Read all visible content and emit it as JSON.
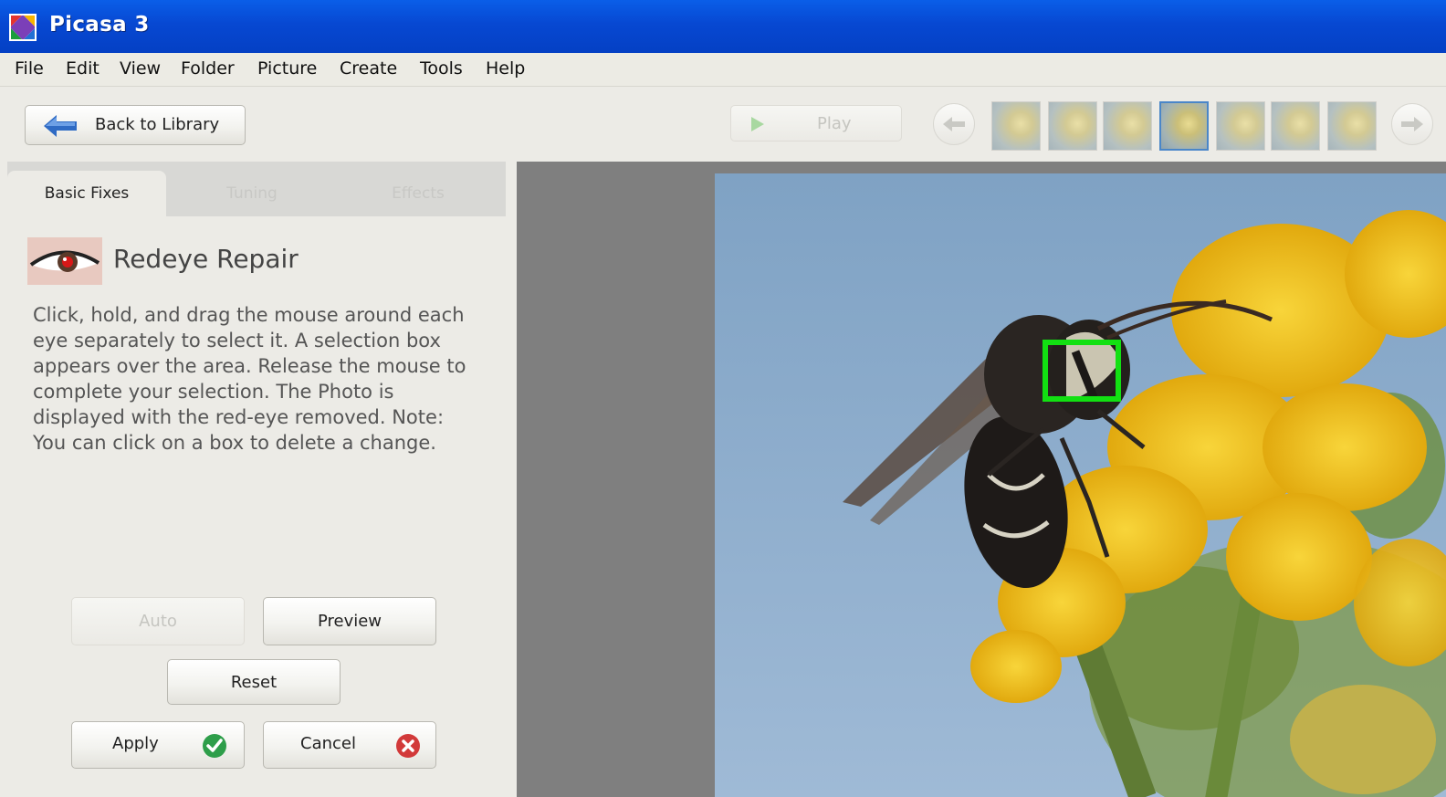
{
  "app": {
    "title": "Picasa 3"
  },
  "menu": [
    "File",
    "Edit",
    "View",
    "Folder",
    "Picture",
    "Create",
    "Tools",
    "Help"
  ],
  "toolbar": {
    "back_label": "Back to Library",
    "play_label": "Play",
    "thumbnails_count_visible": 7,
    "active_thumbnail_index": 3
  },
  "tabs": [
    {
      "label": "Basic Fixes",
      "active": true
    },
    {
      "label": "Tuning",
      "active": false
    },
    {
      "label": "Effects",
      "active": false
    }
  ],
  "tool": {
    "title": "Redeye Repair",
    "description": "Click, hold, and drag the mouse around each eye separately to select it. A selection box appears over the area.  Release the mouse to complete your selection. The Photo is displayed with the red-eye removed. Note: You can click on a box to delete a change."
  },
  "buttons": {
    "auto": "Auto",
    "preview": "Preview",
    "reset": "Reset",
    "apply": "Apply",
    "cancel": "Cancel"
  },
  "colors": {
    "titlebar": "#0748d2",
    "selection_box": "#12e012",
    "apply_badge": "#2e9e4a",
    "cancel_badge": "#d23a3a",
    "sky": "#8fb0cf",
    "flower": "#f0c21a"
  }
}
